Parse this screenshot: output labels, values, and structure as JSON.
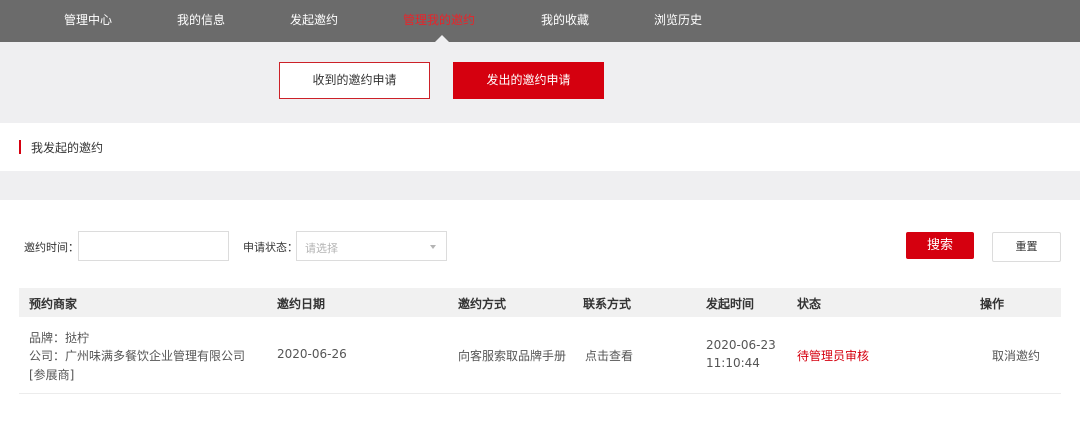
{
  "nav": {
    "items": [
      {
        "label": "管理中心",
        "active": false
      },
      {
        "label": "我的信息",
        "active": false
      },
      {
        "label": "发起邀约",
        "active": false
      },
      {
        "label": "管理我的邀约",
        "active": true
      },
      {
        "label": "我的收藏",
        "active": false
      },
      {
        "label": "浏览历史",
        "active": false
      }
    ]
  },
  "tabs": {
    "received_label": "收到的邀约申请",
    "sent_label": "发出的邀约申请"
  },
  "section_title": "我发起的邀约",
  "filters": {
    "date_label": "邀约时间：",
    "date_value": "",
    "status_label": "申请状态：",
    "status_placeholder": "请选择",
    "search_label": "搜索",
    "reset_label": "重置"
  },
  "table": {
    "headers": [
      "预约商家",
      "邀约日期",
      "邀约方式",
      "联系方式",
      "发起时间",
      "状态",
      "操作"
    ],
    "rows": [
      {
        "brand": "品牌：挞柠",
        "company": "公司：广州味满多餐饮企业管理有限公司",
        "type": "[参展商]",
        "invite_date": "2020-06-26",
        "invite_method": "向客服索取品牌手册",
        "contact": "点击查看",
        "created_date": "2020-06-23",
        "created_time": "11:10:44",
        "status": "待管理员审核",
        "action": "取消邀约"
      }
    ]
  },
  "colors": {
    "nav_bg": "#6b6b6b",
    "accent_red": "#d5000f",
    "page_bg": "#efeff1"
  }
}
